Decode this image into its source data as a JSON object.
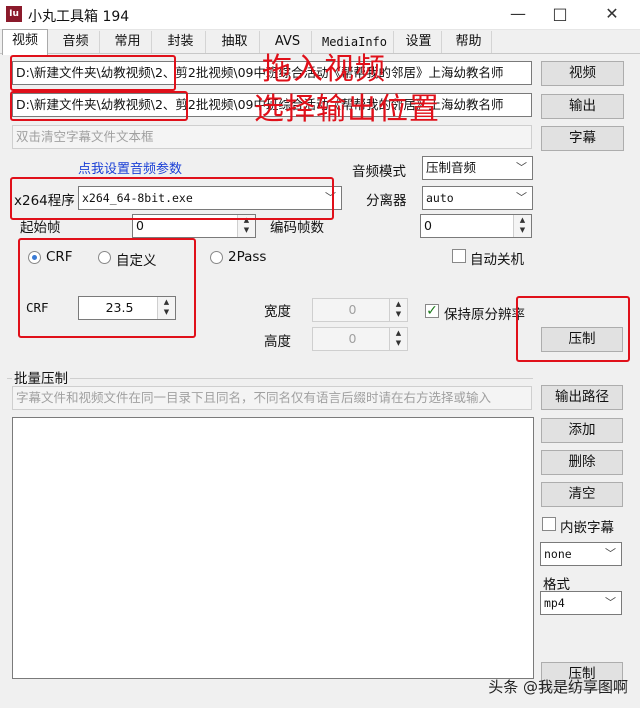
{
  "window": {
    "title": "小丸工具箱 194",
    "icon_text": "Iu"
  },
  "controls": {
    "minimize": "—",
    "maximize": "□",
    "close": "✕"
  },
  "tabs": [
    "视频",
    "音频",
    "常用",
    "封装",
    "抽取",
    "AVS",
    "MediaInfo",
    "设置",
    "帮助"
  ],
  "video": {
    "input_path": "D:\\新建文件夹\\幼教视频\\2、剪2批视频\\09中班综合活动《帮帮我的邻居》上海幼教名师",
    "output_path": "D:\\新建文件夹\\幼教视频\\2、剪2批视频\\09中班综合活动《帮帮我的邻居》上海幼教名师",
    "subtitle_placeholder": "双击清空字幕文件文本框",
    "btn_video": "视频",
    "btn_output": "输出",
    "btn_subtitle": "字幕",
    "audio_settings_link": "点我设置音频参数",
    "audio_mode_label": "音频模式",
    "audio_mode_value": "压制音频",
    "x264_label": "x264程序",
    "x264_value": "x264_64-8bit.exe",
    "splitter_label": "分离器",
    "splitter_value": "auto",
    "start_frame_label": "起始帧",
    "start_frame_value": "0",
    "encode_frames_label": "编码帧数",
    "encode_frames_value": "0",
    "mode_crf": "CRF",
    "mode_custom": "自定义",
    "mode_2pass": "2Pass",
    "auto_shutdown": "自动关机",
    "crf_label": "CRF",
    "crf_value": "23.5",
    "width_label": "宽度",
    "width_value": "0",
    "height_label": "高度",
    "height_value": "0",
    "keep_resolution": "保持原分辨率",
    "btn_encode": "压制"
  },
  "batch": {
    "legend": "批量压制",
    "hint_placeholder": "字幕文件和视频文件在同一目录下且同名，不同名仅有语言后缀时请在右方选择或输入",
    "btn_output_path": "输出路径",
    "btn_add": "添加",
    "btn_delete": "删除",
    "btn_clear": "清空",
    "embed_subtitle": "内嵌字幕",
    "subtitle_lang_value": "none",
    "format_label": "格式",
    "format_value": "mp4",
    "btn_encode_partial": "压制"
  },
  "annotations": {
    "drag_video": "拖入视频",
    "choose_output": "选择输出位置"
  },
  "watermark": "头条 @我是纺享图啊",
  "colors": {
    "annotation_red": "#e0101a",
    "link_blue": "#1a3fd6",
    "icon_red": "#8b1a2b"
  }
}
